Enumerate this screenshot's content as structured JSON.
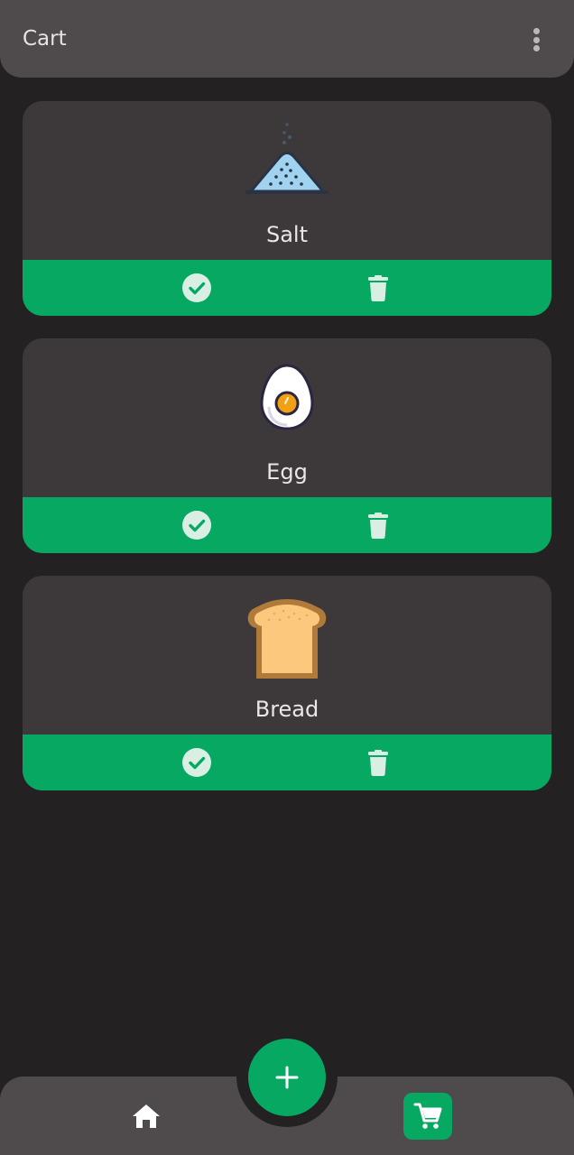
{
  "appbar": {
    "title": "Cart",
    "menu_icon": "more-vert-icon"
  },
  "items": [
    {
      "label": "Salt",
      "icon": "salt-icon"
    },
    {
      "label": "Egg",
      "icon": "boiled-egg-icon"
    },
    {
      "label": "Bread",
      "icon": "bread-slice-icon"
    }
  ],
  "item_actions": {
    "check_icon": "check-circle-icon",
    "delete_icon": "trash-icon"
  },
  "bottom_nav": {
    "home_icon": "home-icon",
    "add_icon": "plus-icon",
    "cart_icon": "cart-icon"
  },
  "colors": {
    "accent": "#07a862",
    "surface": "#3d393a",
    "background": "#232122",
    "bar": "#4f4a4b"
  }
}
